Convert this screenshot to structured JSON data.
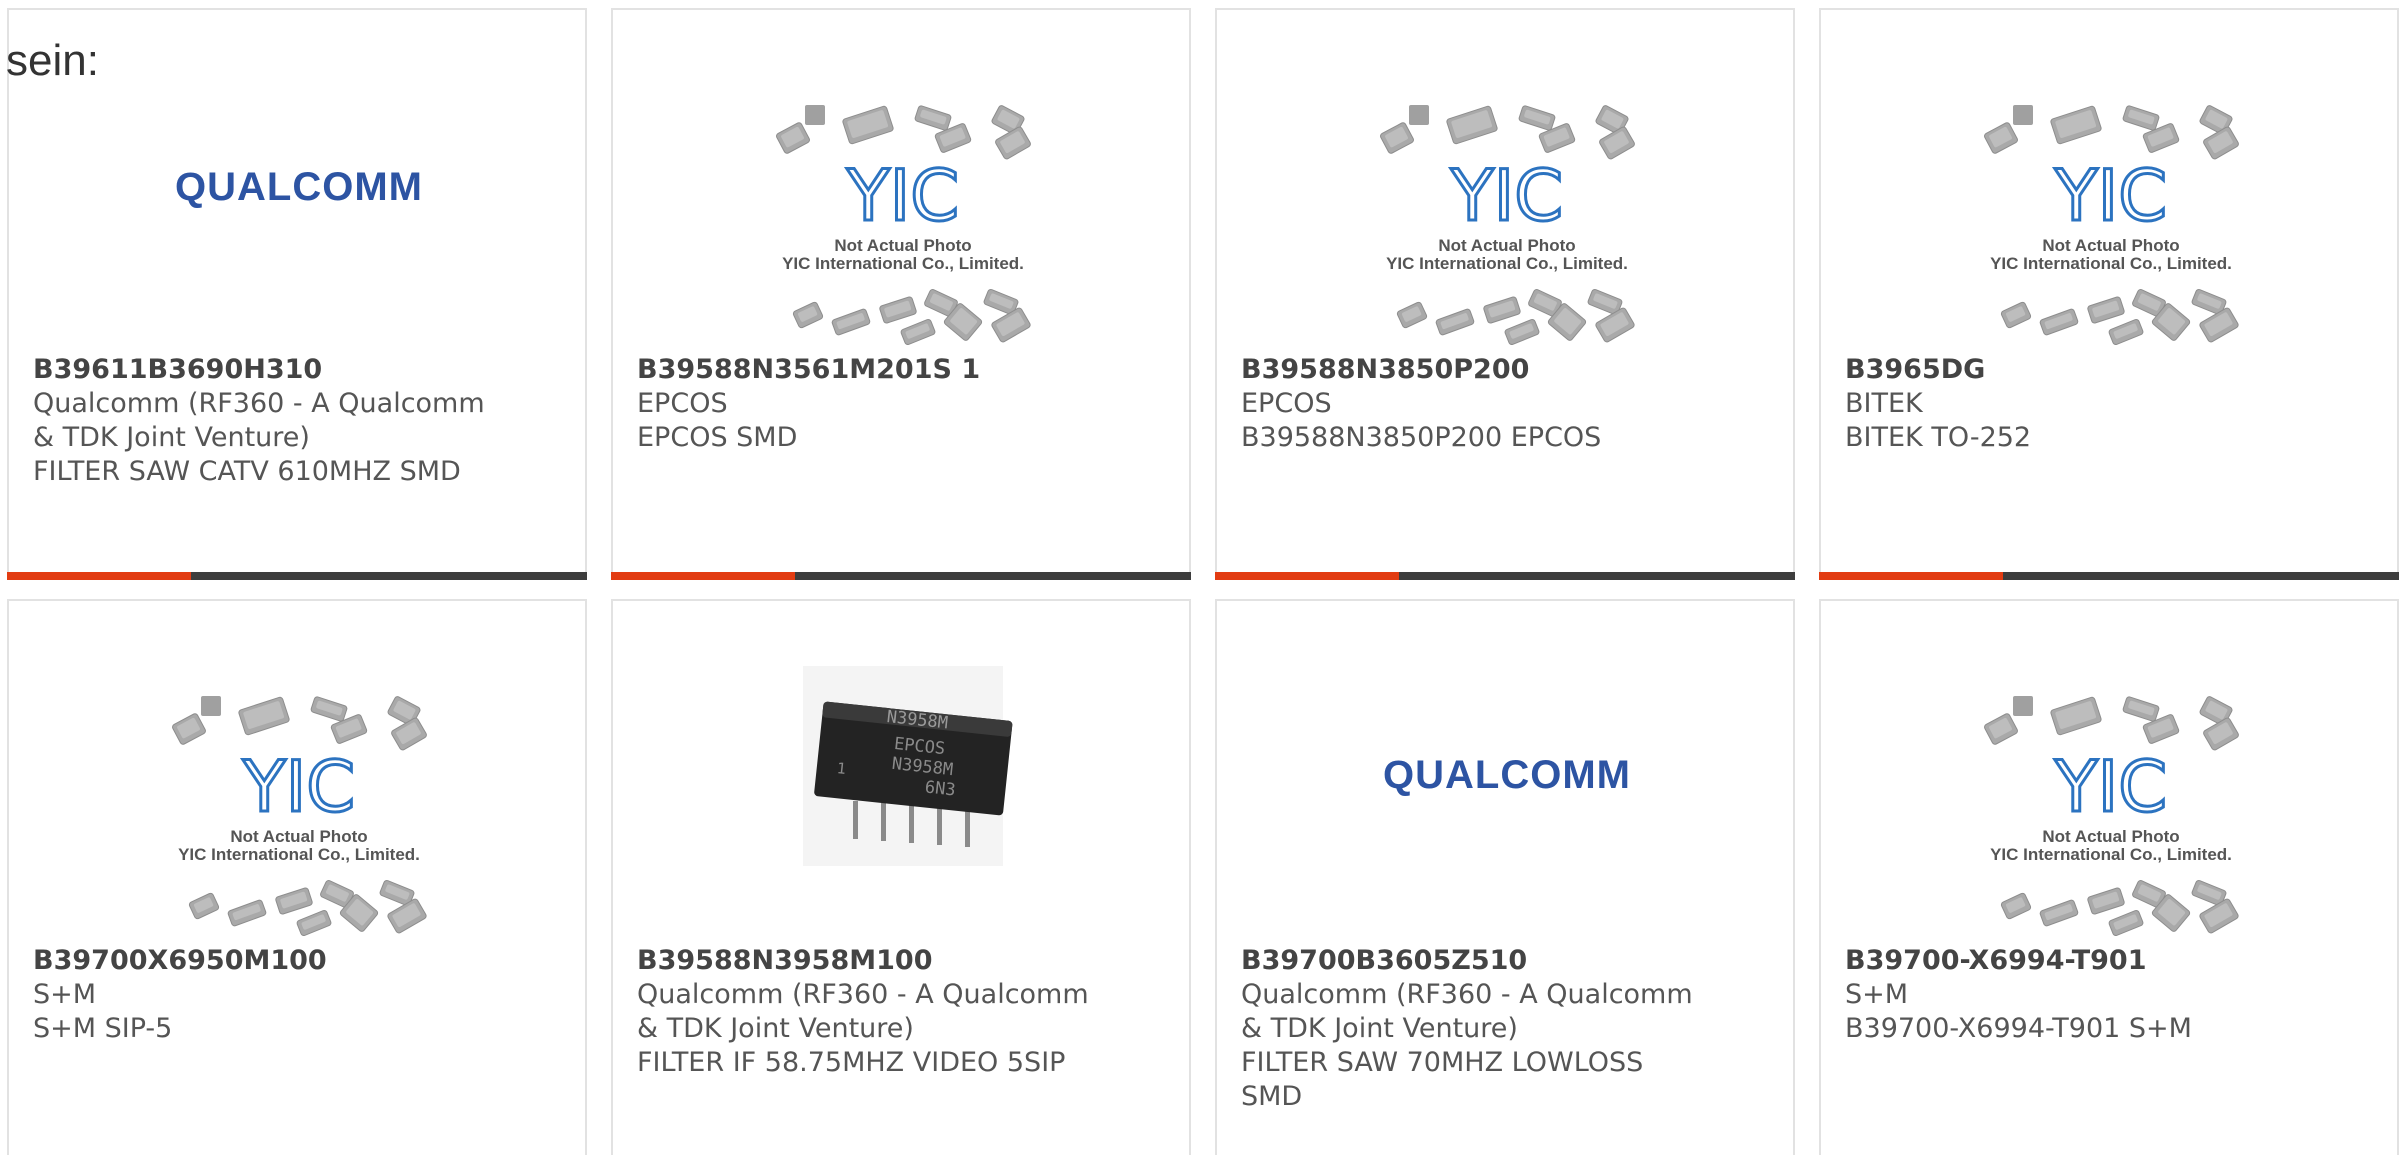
{
  "intro_text": "sein:",
  "colors": {
    "accent": "#e23c12",
    "bar": "#3d3d3d",
    "border": "#e2e2e2",
    "text": "#555555",
    "qualcomm_blue": "#2d54a3",
    "yic_blue": "#2c73c0"
  },
  "placeholder": {
    "line1": "Not Actual Photo",
    "line2": "YIC International Co., Limited."
  },
  "logos": {
    "qualcomm": "QUALCOMM",
    "yic": "YIC"
  },
  "photo": {
    "chip_line1": "N3958M",
    "chip_line2": "EPCOS",
    "chip_line3": "N3958M",
    "chip_line4": "6N3",
    "chip_pin": "1"
  },
  "products": [
    {
      "part": "B39611B3690H310",
      "mfr": "Qualcomm (RF360 - A Qualcomm & TDK Joint Venture)",
      "desc": "FILTER SAW CATV 610MHZ SMD",
      "image": "qualcomm-logo"
    },
    {
      "part": "B39588N3561M201S 1",
      "mfr": "EPCOS",
      "desc": "EPCOS SMD",
      "image": "not-actual-photo"
    },
    {
      "part": "B39588N3850P200",
      "mfr": "EPCOS",
      "desc": "B39588N3850P200 EPCOS",
      "image": "not-actual-photo"
    },
    {
      "part": "B3965DG",
      "mfr": "BITEK",
      "desc": "BITEK TO-252",
      "image": "not-actual-photo"
    },
    {
      "part": "B39700X6950M100",
      "mfr": "S+M",
      "desc": "S+M SIP-5",
      "image": "not-actual-photo"
    },
    {
      "part": "B39588N3958M100",
      "mfr": "Qualcomm (RF360 - A Qualcomm & TDK Joint Venture)",
      "desc": "FILTER IF 58.75MHZ VIDEO 5SIP",
      "image": "product-photo"
    },
    {
      "part": "B39700B3605Z510",
      "mfr": "Qualcomm (RF360 - A Qualcomm & TDK Joint Venture)",
      "desc": "FILTER SAW 70MHZ LOWLOSS SMD",
      "image": "qualcomm-logo"
    },
    {
      "part": "B39700-X6994-T901",
      "mfr": "S+M",
      "desc": "B39700-X6994-T901 S+M",
      "image": "not-actual-photo"
    }
  ]
}
